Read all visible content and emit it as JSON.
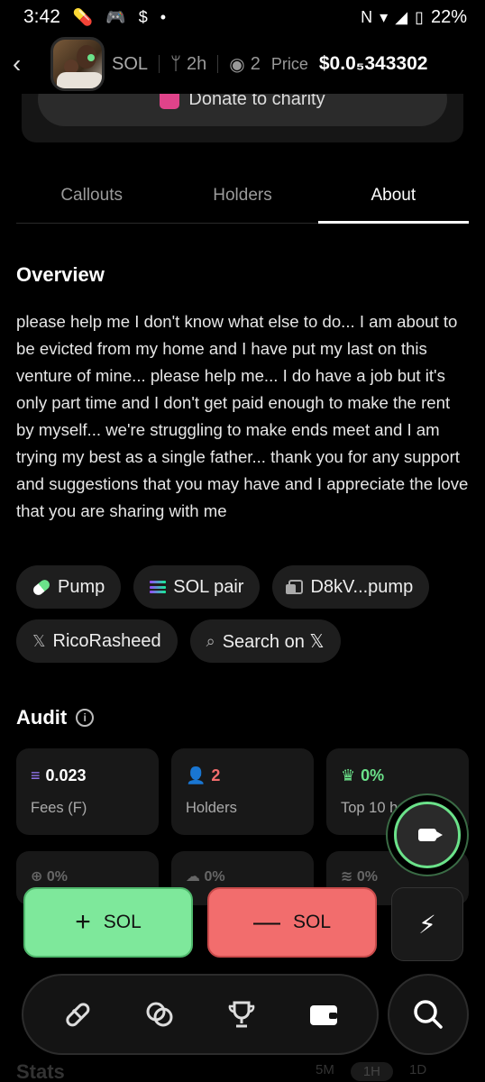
{
  "status_bar": {
    "time": "3:42",
    "battery": "22%",
    "notif_icons": [
      "pill-icon",
      "discord-icon",
      "dollar-icon",
      "dot-icon"
    ]
  },
  "nav": {
    "ticker": "SOL",
    "age": "2h",
    "viewers": "2",
    "price_label": "Price",
    "price": "$0.0₅343302"
  },
  "charity": {
    "label": "Donate to charity"
  },
  "tabs": [
    {
      "label": "Callouts",
      "active": false
    },
    {
      "label": "Holders",
      "active": false
    },
    {
      "label": "About",
      "active": true
    }
  ],
  "overview": {
    "title": "Overview",
    "text": "please help me I don't know what else to do... I am about to be evicted from my home and I have put my last on this venture of mine... please help me... I do have a job but it's only part time and I don't get paid enough to make the rent by myself... we're struggling to make ends meet and I am trying my best as a single father... thank you for any support and suggestions that you may have and I appreciate the love that you are sharing with me"
  },
  "chips": {
    "row1": [
      "Pump",
      "SOL pair",
      "D8kV...pump"
    ],
    "row2": [
      "RicoRasheed",
      "Search on 𝕏"
    ]
  },
  "audit": {
    "title": "Audit",
    "cards": [
      {
        "value": "0.023",
        "label": "Fees (F)",
        "color": "#9b7bff"
      },
      {
        "value": "2",
        "label": "Holders",
        "color": "#f26d6d"
      },
      {
        "value": "0%",
        "label": "Top 10 hol",
        "color": "#6be28a"
      }
    ],
    "cards2": [
      "0%",
      "0%",
      "0%"
    ]
  },
  "trade": {
    "buy": "SOL",
    "sell": "SOL"
  },
  "stats": {
    "title": "Stats",
    "ranges": [
      "5M",
      "1H",
      "1D"
    ]
  },
  "colors": {
    "buy": "#7ee89b",
    "sell": "#f26d6d",
    "accent": "#6be28a"
  }
}
